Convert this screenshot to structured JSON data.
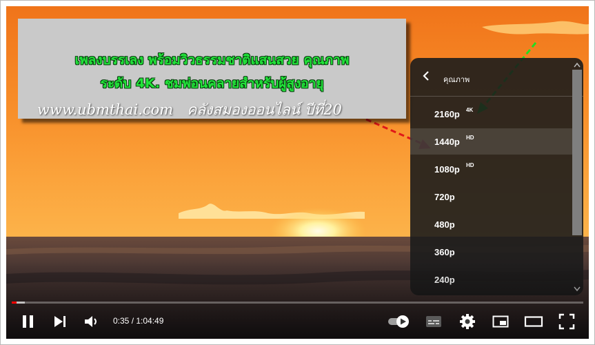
{
  "caption": {
    "line1": "เพลงบรรเลง พร้อมวิวธรรมชาติแสนสวย คุณภาพ",
    "line2": "ระดับ 4K. ชมพ่อนคลายสำหรับผู้สูงอายุ",
    "website": "www.ubmthai.com",
    "tagline": "คลังสมองออนไลน์ ปีที่20"
  },
  "quality_menu": {
    "title": "คุณภาพ",
    "items": [
      {
        "label": "2160p",
        "badge": "4K",
        "selected": false
      },
      {
        "label": "1440p",
        "badge": "HD",
        "selected": true
      },
      {
        "label": "1080p",
        "badge": "HD",
        "selected": false
      },
      {
        "label": "720p",
        "badge": "",
        "selected": false
      },
      {
        "label": "480p",
        "badge": "",
        "selected": false
      },
      {
        "label": "360p",
        "badge": "",
        "selected": false
      },
      {
        "label": "240p",
        "badge": "",
        "selected": false
      }
    ]
  },
  "player": {
    "current_time": "0:35",
    "duration": "1:04:49",
    "time_display": "0:35 / 1:04:49",
    "progress_fraction": 0.009,
    "buffered_fraction": 0.023,
    "progress_color": "#ff0000"
  },
  "controls": {
    "icons": [
      "pause-icon",
      "next-icon",
      "volume-icon",
      "autoplay-toggle-icon",
      "subtitles-icon",
      "settings-gear-icon",
      "miniplayer-icon",
      "theater-mode-icon",
      "fullscreen-icon"
    ]
  },
  "colors": {
    "caption_text": "#22e43a",
    "arrow_green": "#22dd22",
    "arrow_red": "#e01818"
  }
}
